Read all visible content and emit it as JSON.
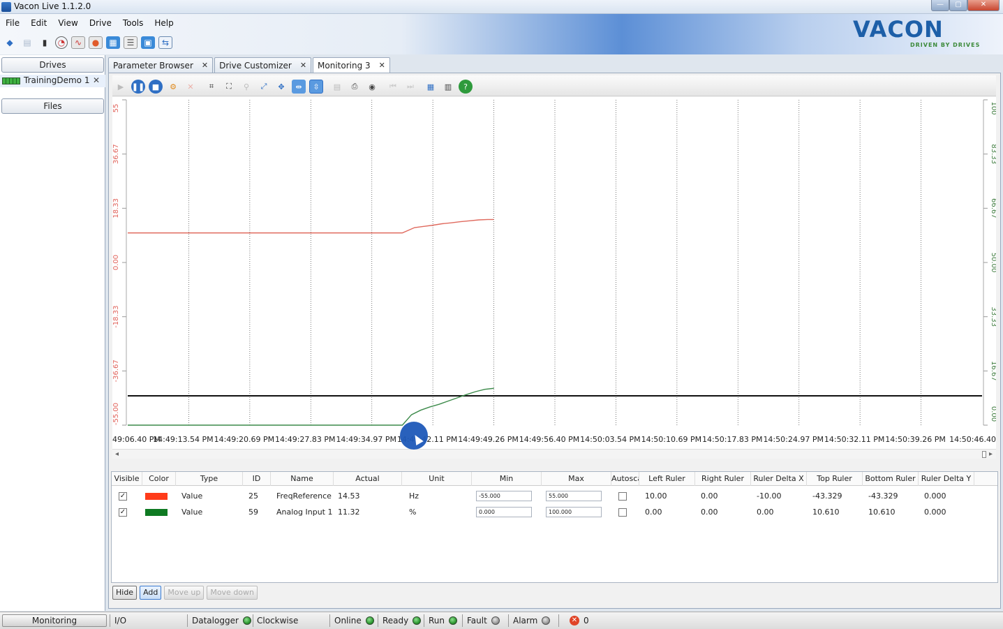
{
  "window": {
    "title": "Vacon Live 1.1.2.0"
  },
  "menu": [
    "File",
    "Edit",
    "View",
    "Drive",
    "Tools",
    "Help"
  ],
  "logo": {
    "brand": "VACON",
    "tagline": "DRIVEN BY DRIVES"
  },
  "left_pane": {
    "drives_button": "Drives",
    "drive_item": "TrainingDemo 1",
    "files_button": "Files"
  },
  "tabs": [
    {
      "label": "Parameter Browser",
      "active": false
    },
    {
      "label": "Drive Customizer",
      "active": false
    },
    {
      "label": "Monitoring 3",
      "active": true
    }
  ],
  "chart_data": {
    "type": "line",
    "x_tick_labels": [
      "49:06.40 PM",
      "14:49:13.54 PM",
      "14:49:20.69 PM",
      "14:49:27.83 PM",
      "14:49:34.97 PM",
      "14:49:42.11 PM",
      "14:49:49.26 PM",
      "14:49:56.40 PM",
      "14:50:03.54 PM",
      "14:50:10.69 PM",
      "14:50:17.83 PM",
      "14:50:24.97 PM",
      "14:50:32.11 PM",
      "14:50:39.26 PM",
      "14:50:46.40"
    ],
    "left_axis": {
      "ticks": [
        "55",
        "36.67",
        "18.33",
        "0.00",
        "-18.33",
        "-36.67",
        "-55.00"
      ],
      "range": [
        -55,
        55
      ],
      "color": "#e0625a"
    },
    "right_axis": {
      "ticks": [
        "100",
        "83.33",
        "66.67",
        "50.00",
        "33.33",
        "16.67",
        "0.00"
      ],
      "range": [
        0,
        100
      ],
      "color": "#3c7a3c"
    },
    "grid": true,
    "series": [
      {
        "name": "FreqReference",
        "color": "#e06a5e",
        "axis": "left",
        "x": [
          0,
          4.5,
          4.7,
          4.85,
          5.0,
          5.15,
          5.3,
          5.45,
          5.6,
          5.75,
          5.9,
          6.0
        ],
        "y": [
          10.0,
          10.0,
          11.8,
          12.2,
          12.6,
          13.1,
          13.4,
          13.8,
          14.1,
          14.4,
          14.53,
          14.53
        ]
      },
      {
        "name": "Analog Input 1",
        "color": "#3c8a4a",
        "axis": "right",
        "x": [
          0,
          4.5,
          4.65,
          4.8,
          4.95,
          5.1,
          5.25,
          5.4,
          5.55,
          5.7,
          5.85,
          6.0
        ],
        "y": [
          0.0,
          0.0,
          3.2,
          4.6,
          5.6,
          6.4,
          7.4,
          8.4,
          9.4,
          10.3,
          11.0,
          11.32
        ]
      }
    ],
    "reference_line": {
      "axis": "right",
      "y": 9.0,
      "color": "#111111"
    }
  },
  "table": {
    "headers": [
      "Visible",
      "Color",
      "Type",
      "ID",
      "Name",
      "Actual",
      "Unit",
      "Min",
      "Max",
      "Autosca",
      "Left Ruler",
      "Right Ruler",
      "Ruler Delta X",
      "Top Ruler",
      "Bottom Ruler",
      "Ruler Delta Y"
    ],
    "rows": [
      {
        "visible": "✓",
        "color": "#ff3b1a",
        "type": "Value",
        "id": "25",
        "name": "FreqReference",
        "actual": "14.53",
        "unit": "Hz",
        "min": "-55.000",
        "max": "55.000",
        "left_ruler": "10.00",
        "right_ruler": "0.00",
        "ruler_dx": "-10.00",
        "top_ruler": "-43.329",
        "bottom_ruler": "-43.329",
        "ruler_dy": "0.000"
      },
      {
        "visible": "✓",
        "color": "#0e7a22",
        "type": "Value",
        "id": "59",
        "name": "Analog Input 1",
        "actual": "11.32",
        "unit": "%",
        "min": "0.000",
        "max": "100.000",
        "left_ruler": "0.00",
        "right_ruler": "0.00",
        "ruler_dx": "0.00",
        "top_ruler": "10.610",
        "bottom_ruler": "10.610",
        "ruler_dy": "0.000"
      }
    ]
  },
  "table_buttons": {
    "hide": "Hide",
    "add": "Add",
    "move_up": "Move up",
    "move_down": "Move down"
  },
  "statusbar": {
    "monitoring": "Monitoring",
    "io": "I/O",
    "datalogger": "Datalogger",
    "direction": "Clockwise",
    "online": "Online",
    "ready": "Ready",
    "run": "Run",
    "fault": "Fault",
    "alarm": "Alarm",
    "error_count": "0"
  }
}
